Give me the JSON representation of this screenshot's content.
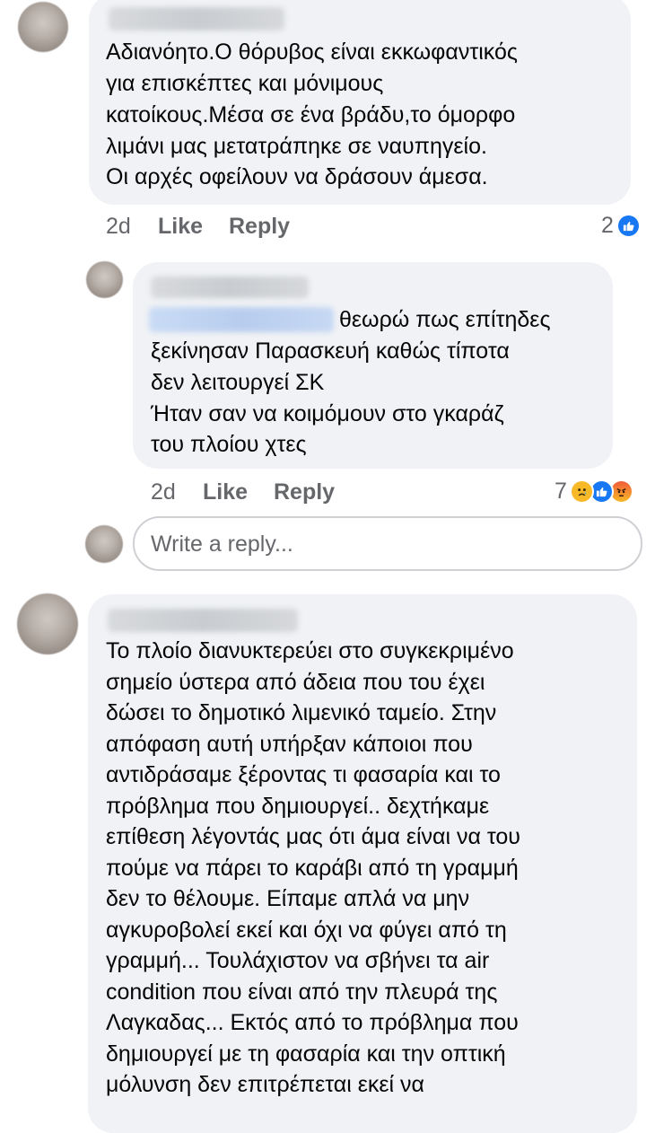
{
  "comments": [
    {
      "text_lines": [
        "Αδιανόητο.Ο θόρυβος είναι εκκωφαντικός",
        "για επισκέπτες και μόνιμους",
        "κατοίκους.Μέσα σε ένα βράδυ,το όμορφο",
        "λιμάνι μας μετατράπηκε σε ναυπηγείο.",
        "Οι αρχές οφείλουν να δράσουν άμεσα."
      ],
      "time": "2d",
      "like_label": "Like",
      "reply_label": "Reply",
      "reaction_count": "2",
      "reactions": [
        "like"
      ]
    },
    {
      "first_line": "θεωρώ πως επίτηδες",
      "text_lines": [
        "ξεκίνησαν  Παρασκευή καθώς τίποτα",
        "δεν λειτουργεί ΣΚ",
        "Ήταν σαν να κοιμόμουν στο γκαράζ",
        "του πλοίου χτες"
      ],
      "time": "2d",
      "like_label": "Like",
      "reply_label": "Reply",
      "reaction_count": "7",
      "reactions": [
        "sad",
        "like",
        "angry"
      ]
    },
    {
      "text_lines": [
        "Το  πλοίο διανυκτερεύει στο συγκεκριμένο",
        "σημείο ύστερα από άδεια που του έχει",
        "δώσει το δημοτικό λιμενικό ταμείο. Στην",
        "απόφαση αυτή υπήρξαν κάποιοι που",
        "αντιδράσαμε ξέροντας τι φασαρία και το",
        "πρόβλημα που δημιουργεί.. δεχτήκαμε",
        "επίθεση λέγοντάς μας ότι άμα είναι να του",
        "πούμε να πάρει το καράβι από τη γραμμή",
        "δεν το θέλουμε. Είπαμε απλά να μην",
        "αγκυροβολεί εκεί και όχι να φύγει από τη",
        "γραμμή... Τουλάχιστον να σβήνει τα air",
        "condition που είναι από την πλευρά της",
        "Λαγκαδας... Εκτός από το πρόβλημα που",
        "δημιουργεί με τη φασαρία και την οπτική",
        "μόλυνση δεν επιτρέπεται εκεί να"
      ]
    }
  ],
  "reply_box": {
    "placeholder": "Write a reply..."
  }
}
